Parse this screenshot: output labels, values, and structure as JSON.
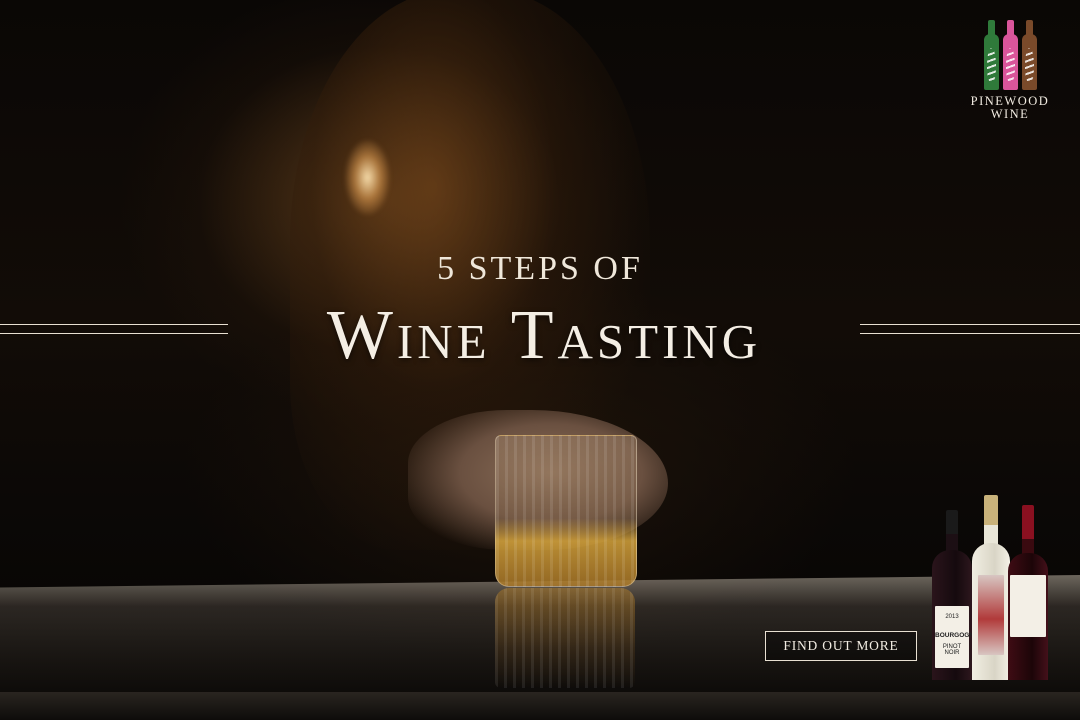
{
  "banner": {
    "subtitle": "5 STEPS OF",
    "title": "Wine Tasting",
    "cta_label": "FIND OUT MORE"
  },
  "logo": {
    "line1": "PINEWOOD",
    "line2": "WINE",
    "bottle_colors": [
      "#2f7a3a",
      "#d9559a",
      "#7a4a2a"
    ]
  },
  "products": [
    {
      "name": "BOURGOGNE",
      "sub": "PINOT NOIR",
      "year": "2013",
      "glass_color": "#1c0f14",
      "capsule_color": "#1a1a1a"
    },
    {
      "name": "",
      "sub": "",
      "year": "",
      "glass_color": "#e9e6d8",
      "capsule_color": "#c9b27a"
    },
    {
      "name": "",
      "sub": "",
      "year": "",
      "glass_color": "#3a0a10",
      "capsule_color": "#8a1020"
    }
  ],
  "colors": {
    "text": "#f4eee4",
    "background": "#0b0806",
    "amber": "#d9a13c"
  }
}
